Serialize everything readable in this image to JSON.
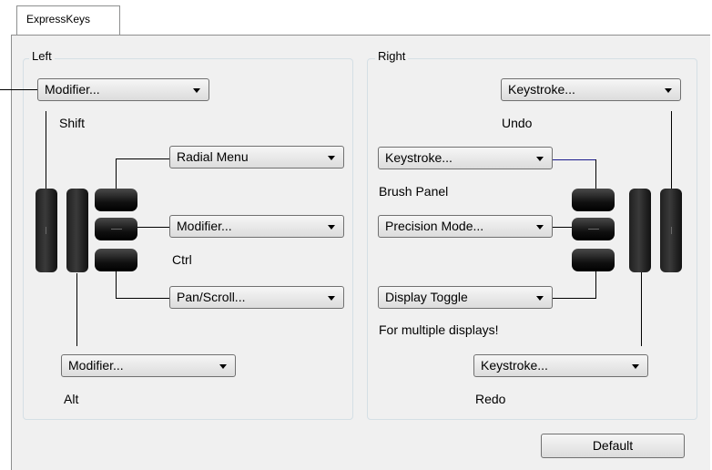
{
  "tab": {
    "label": "ExpressKeys"
  },
  "left": {
    "title": "Left",
    "top_dropdown": "Modifier...",
    "top_label": "Shift",
    "radial_dropdown": "Radial Menu",
    "mid_dropdown": "Modifier...",
    "mid_label": "Ctrl",
    "pan_dropdown": "Pan/Scroll...",
    "bottom_dropdown": "Modifier...",
    "bottom_label": "Alt"
  },
  "right": {
    "title": "Right",
    "top_dropdown": "Keystroke...",
    "top_label": "Undo",
    "upper_dropdown": "Keystroke...",
    "upper_label": "Brush Panel",
    "mid_dropdown": "Precision Mode...",
    "display_dropdown": "Display Toggle",
    "display_label": "For multiple displays!",
    "bottom_dropdown": "Keystroke...",
    "bottom_label": "Redo"
  },
  "buttons": {
    "default": "Default"
  }
}
